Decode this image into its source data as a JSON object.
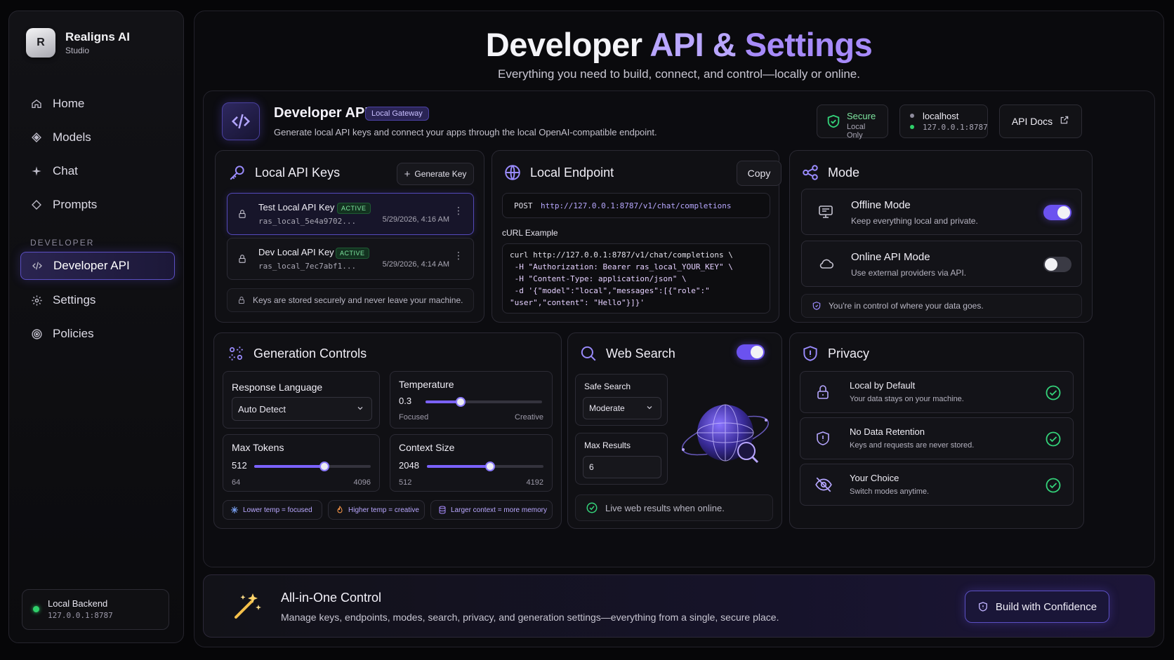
{
  "app": {
    "name": "Realigns AI",
    "subtitle": "Studio",
    "logo_letter": "R"
  },
  "sidebar": {
    "items": [
      {
        "label": "Home",
        "icon": "home-icon"
      },
      {
        "label": "Models",
        "icon": "diamond-icon"
      },
      {
        "label": "Chat",
        "icon": "sparkle-icon"
      },
      {
        "label": "Prompts",
        "icon": "diamond-outline-icon"
      }
    ],
    "section_label": "DEVELOPER",
    "dev_items": [
      {
        "label": "Developer API",
        "icon": "code-icon",
        "active": true
      },
      {
        "label": "Settings",
        "icon": "gear-icon"
      },
      {
        "label": "Policies",
        "icon": "target-icon"
      }
    ],
    "backend": {
      "title": "Local Backend",
      "address": "127.0.0.1:8787",
      "status_color": "#2fd06a"
    }
  },
  "header": {
    "title_part1": "Developer",
    "title_part2": "API &",
    "title_part3": "Settings",
    "subtitle": "Everything you need to build, connect, and control—locally or online."
  },
  "developer_api": {
    "title": "Developer API",
    "badge": "Local Gateway",
    "description": "Generate local API keys and connect your apps through the local OpenAI-compatible endpoint.",
    "secure_label": "Secure",
    "secure_sub": "Local Only",
    "host_label": "localhost",
    "host_address": "127.0.0.1:8787",
    "docs_label": "API Docs"
  },
  "api_keys": {
    "title": "Local API Keys",
    "generate_label": "Generate Key",
    "keys": [
      {
        "name": "Test Local API Key",
        "status": "ACTIVE",
        "value": "ras_local_5e4a9702...",
        "date": "5/29/2026, 4:16 AM"
      },
      {
        "name": "Dev Local API Key",
        "status": "ACTIVE",
        "value": "ras_local_7ec7abf1...",
        "date": "5/29/2026, 4:14 AM"
      }
    ],
    "note": "Keys are stored securely and never leave your machine."
  },
  "endpoint": {
    "title": "Local Endpoint",
    "copy_label": "Copy",
    "method": "POST",
    "url": "http://127.0.0.1:8787/v1/chat/completions",
    "curl_label": "cURL Example",
    "curl_lines": [
      "curl http://127.0.0.1:8787/v1/chat/completions \\",
      " -H \"Authorization: Bearer ras_local_YOUR_KEY\" \\",
      " -H \"Content-Type: application/json\" \\",
      " -d '{\"model\":\"local\",\"messages\":[{\"role\":\"",
      "\"user\",\"content\": \"Hello\"}]}'"
    ]
  },
  "mode": {
    "title": "Mode",
    "offline": {
      "name": "Offline Mode",
      "desc": "Keep everything local and private.",
      "enabled": true
    },
    "online": {
      "name": "Online API Mode",
      "desc": "Use external providers via API.",
      "enabled": false
    },
    "note": "You're in control of where your data goes."
  },
  "generation": {
    "title": "Generation Controls",
    "response_language": {
      "label": "Response Language",
      "value": "Auto Detect"
    },
    "temperature": {
      "label": "Temperature",
      "value": "0.3",
      "min_label": "Focused",
      "max_label": "Creative",
      "fraction": 0.3
    },
    "max_tokens": {
      "label": "Max Tokens",
      "value": "512",
      "min": "64",
      "max": "4096",
      "fraction": 0.6
    },
    "context_size": {
      "label": "Context Size",
      "value": "2048",
      "min": "512",
      "max": "4192",
      "fraction": 0.54
    },
    "chips": [
      {
        "label": "Lower temp = focused",
        "icon": "snowflake-icon"
      },
      {
        "label": "Higher temp = creative",
        "icon": "flame-icon"
      },
      {
        "label": "Larger context = more memory",
        "icon": "database-icon"
      }
    ]
  },
  "web_search": {
    "title": "Web Search",
    "enabled": true,
    "safe_search_label": "Safe Search",
    "safe_search_value": "Moderate",
    "max_results_label": "Max Results",
    "max_results_value": "6",
    "note": "Live web results when online."
  },
  "privacy": {
    "title": "Privacy",
    "items": [
      {
        "name": "Local by Default",
        "desc": "Your data stays on your machine."
      },
      {
        "name": "No Data Retention",
        "desc": "Keys and requests are never stored."
      },
      {
        "name": "Your Choice",
        "desc": "Switch modes anytime."
      }
    ]
  },
  "footer": {
    "title": "All-in-One Control",
    "desc": "Manage keys, endpoints, modes, search, privacy, and generation settings—everything from a single, secure place.",
    "button": "Build with Confidence"
  },
  "colors": {
    "accent": "#7b62ff",
    "accent_light": "#b9a6ff",
    "success": "#34d37a"
  }
}
